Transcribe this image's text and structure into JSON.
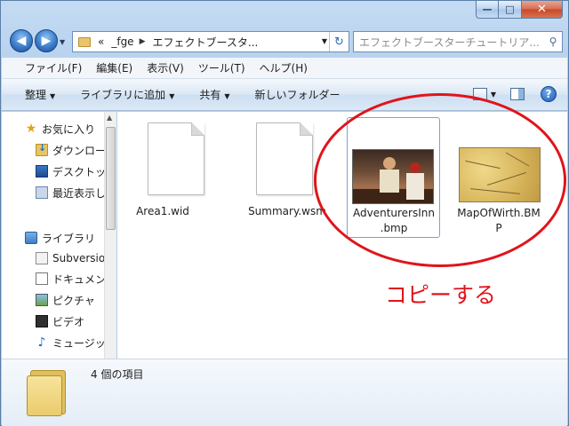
{
  "window": {
    "caption_buttons": {
      "minimize": "—",
      "maximize": "□",
      "close": "✕"
    }
  },
  "nav": {
    "back_glyph": "◀",
    "forward_glyph": "▶",
    "history_dropdown": "▼"
  },
  "address": {
    "overflow": "«",
    "crumb1": "_fge",
    "separator": "▶",
    "crumb2": "エフェクトブースタ...",
    "dropdown": "▼",
    "refresh_glyph": "↻"
  },
  "search": {
    "placeholder": "エフェクトブースターチュートリア...",
    "icon": "search-icon"
  },
  "menubar": {
    "items": [
      "ファイル(F)",
      "編集(E)",
      "表示(V)",
      "ツール(T)",
      "ヘルプ(H)"
    ]
  },
  "commandbar": {
    "organize": "整理",
    "add_to_library": "ライブラリに追加",
    "share": "共有",
    "new_folder": "新しいフォルダー",
    "arrow": "▼",
    "help_glyph": "?"
  },
  "navpane": {
    "favorites": "お気に入り",
    "downloads": "ダウンロード",
    "desktop": "デスクトップ",
    "recent": "最近表示した場所",
    "libraries": "ライブラリ",
    "subversion": "Subversion",
    "documents": "ドキュメント",
    "pictures": "ピクチャ",
    "videos": "ビデオ",
    "music": "ミュージック",
    "music_glyph": "♪",
    "star_glyph": "★",
    "scroll_up": "▲"
  },
  "files": [
    {
      "name": "Area1.wid",
      "kind": "document"
    },
    {
      "name": "Summary.wsm",
      "kind": "document"
    },
    {
      "name_line1": "AdventurersInn",
      "name_line2": ".bmp",
      "kind": "image-tavern"
    },
    {
      "name_line1": "MapOfWirth.BM",
      "name_line2": "P",
      "kind": "image-map"
    }
  ],
  "annotation": {
    "text": "コピーする",
    "color": "#e0141b"
  },
  "details": {
    "item_count": "4 個の項目"
  },
  "colors": {
    "accent": "#3a7cc9",
    "annotation_red": "#e0141b",
    "folder": "#e9c46a"
  }
}
